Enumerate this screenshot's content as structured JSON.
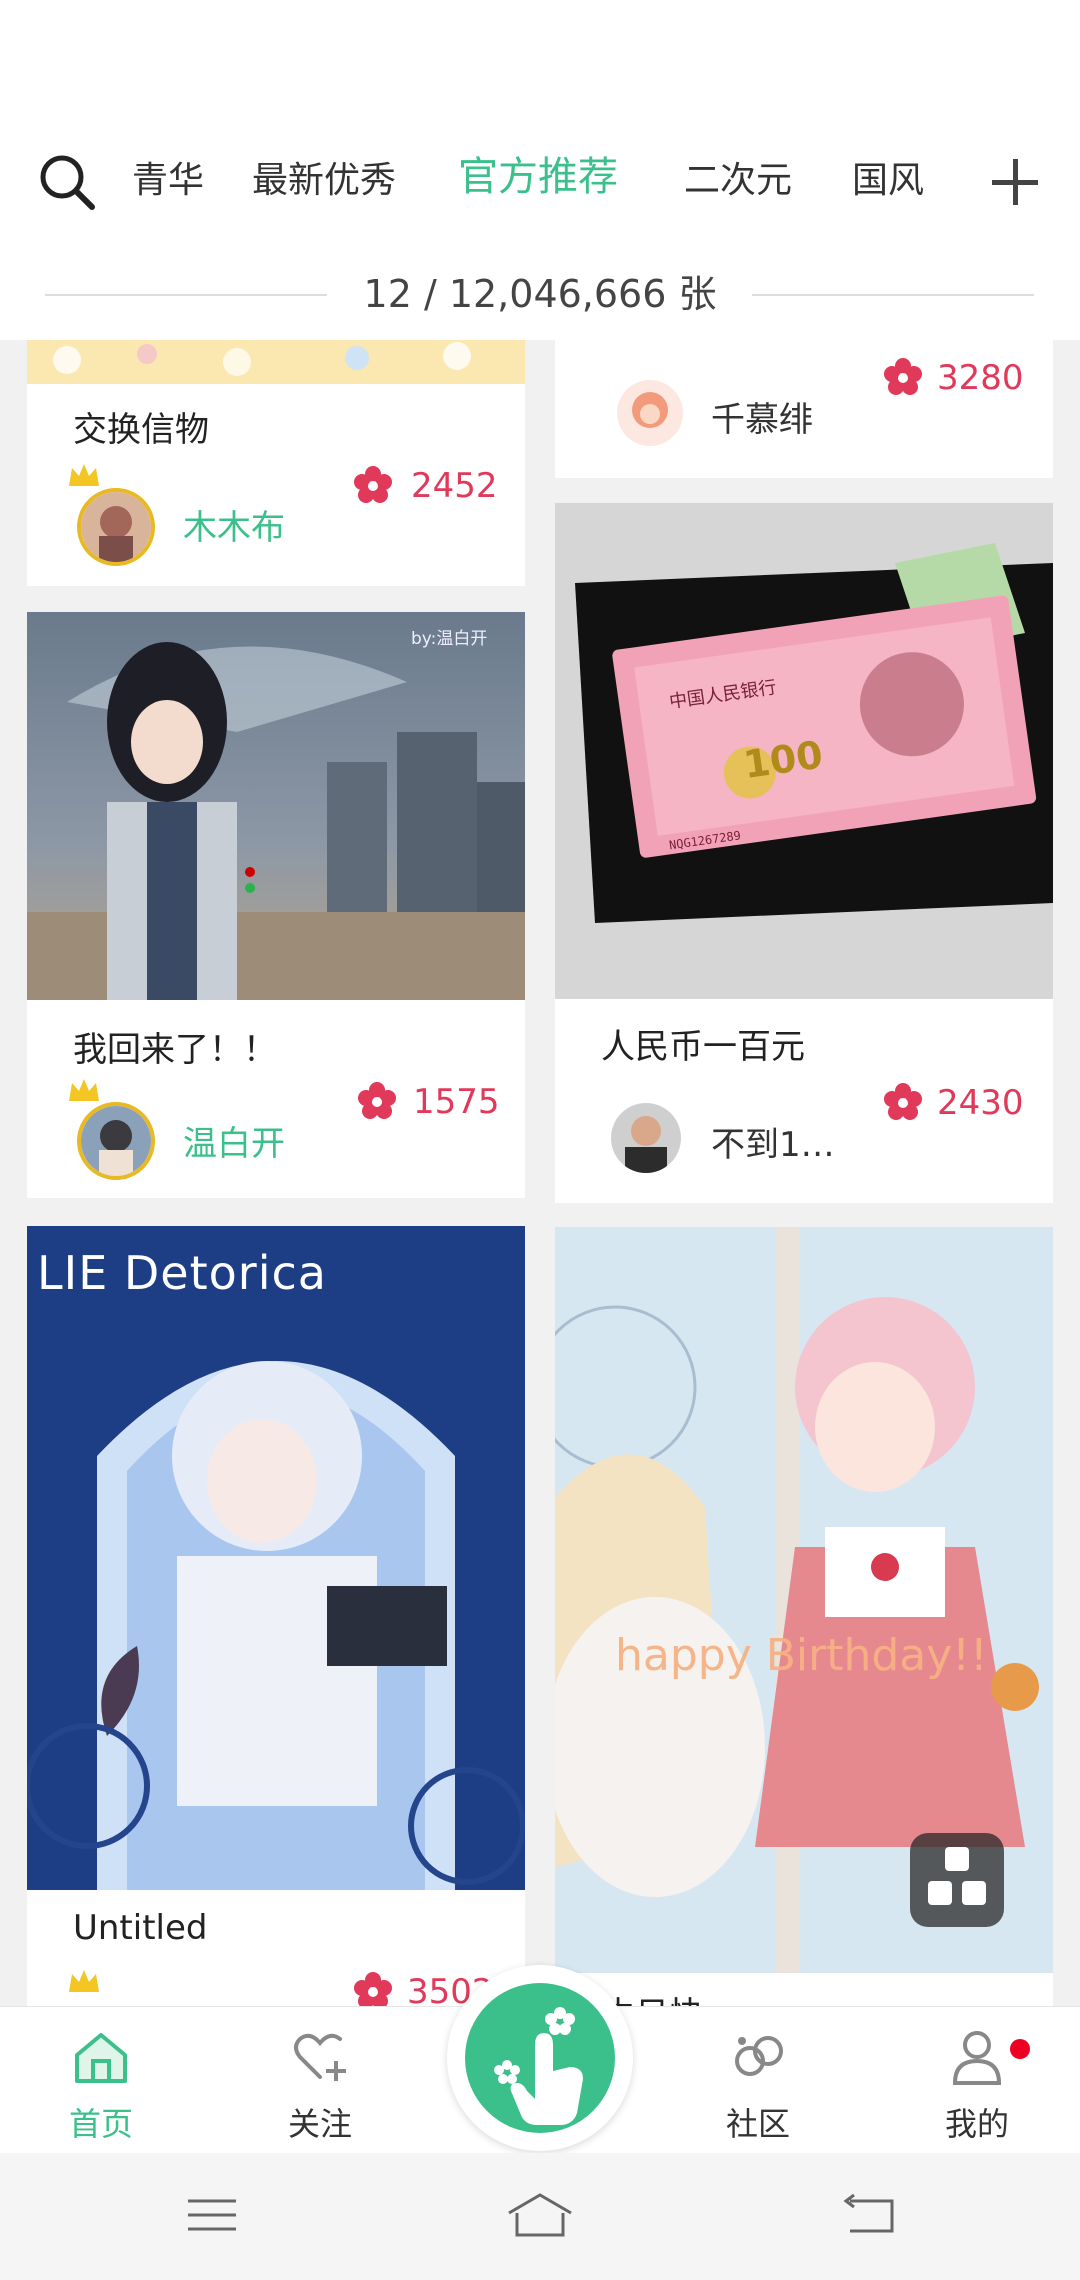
{
  "tabs": {
    "items": [
      "青华",
      "最新优秀",
      "官方推荐",
      "二次元",
      "国风"
    ],
    "active_index": 2,
    "accent": "#3cc08b"
  },
  "counter": "12 / 12,046,666 张",
  "cards": [
    {
      "title": "交换信物",
      "user": "木木布",
      "likes": "2452",
      "vip": true
    },
    {
      "title": "",
      "user": "千慕绯",
      "likes": "3280",
      "vip": false
    },
    {
      "title": "我回来了！！",
      "user": "温白开",
      "likes": "1575",
      "vip": true,
      "art_text": "by:温白开"
    },
    {
      "title": "人民币一百元",
      "user": "不到1…",
      "likes": "2430",
      "vip": false
    },
    {
      "title": "Untitled",
      "user": "",
      "likes": "3502",
      "vip": true,
      "art_text": "LIE Detorica"
    },
    {
      "title": "生日快",
      "user": "",
      "likes": "",
      "vip": false,
      "art_text": "happy Birthday!!"
    }
  ],
  "banknote_value": "100",
  "banknote_bank": "中国人民银行",
  "banknote_serial": "NQG1267289",
  "nav": {
    "home": "首页",
    "follow": "关注",
    "community": "社区",
    "mine": "我的"
  },
  "colors": {
    "accent": "#3cc08b",
    "likes": "#e0395a",
    "badge": "#ee0022"
  }
}
